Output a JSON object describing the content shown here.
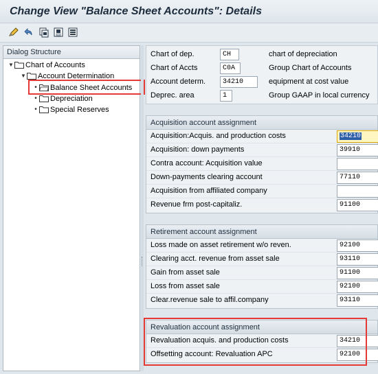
{
  "window": {
    "title": "Change View \"Balance Sheet Accounts\": Details"
  },
  "toolbar": {
    "buttons": [
      "edit-icon",
      "undo-icon",
      "copy-icon",
      "save-icon",
      "list-icon"
    ]
  },
  "dialog_structure": {
    "title": "Dialog Structure",
    "nodes": [
      {
        "label": "Chart of Accounts",
        "level": 0,
        "expanded": true
      },
      {
        "label": "Account Determination",
        "level": 1,
        "expanded": true
      },
      {
        "label": "Balance Sheet Accounts",
        "level": 2,
        "selected": true
      },
      {
        "label": "Depreciation",
        "level": 2
      },
      {
        "label": "Special Reserves",
        "level": 2
      }
    ]
  },
  "header": {
    "rows": [
      {
        "label": "Chart of dep.",
        "value": "CH",
        "desc": "chart of depreciation"
      },
      {
        "label": "Chart of Accts",
        "value": "C0A",
        "desc": "Group Chart of Accounts"
      },
      {
        "label": "Account determ.",
        "value": "34210",
        "desc": "equipment at cost value"
      },
      {
        "label": "Deprec. area",
        "value": "1",
        "desc": "Group GAAP in local currency"
      }
    ]
  },
  "groups": [
    {
      "title": "Acquisition account assignment",
      "rows": [
        {
          "label": "Acquisition:Acquis. and production costs",
          "value": "34210",
          "active": true
        },
        {
          "label": "Acquisition: down payments",
          "value": "39910"
        },
        {
          "label": "Contra account: Acquisition value",
          "value": ""
        },
        {
          "label": "Down-payments clearing account",
          "value": "77110"
        },
        {
          "label": "Acquisition from affiliated company",
          "value": ""
        },
        {
          "label": "Revenue frm post-capitaliz.",
          "value": "91100"
        }
      ]
    },
    {
      "title": "Retirement account assignment",
      "rows": [
        {
          "label": "Loss made on asset retirement w/o reven.",
          "value": "92100"
        },
        {
          "label": "Clearing acct. revenue from asset sale",
          "value": "93110"
        },
        {
          "label": "Gain from asset sale",
          "value": "91100"
        },
        {
          "label": "Loss from asset sale",
          "value": "92100"
        },
        {
          "label": "Clear.revenue sale to affil.company",
          "value": "93110"
        }
      ]
    },
    {
      "title": "Revaluation account assignment",
      "rows": [
        {
          "label": "Revaluation acquis. and production costs",
          "value": "34210"
        },
        {
          "label": "Offsetting account: Revaluation APC",
          "value": "92100"
        }
      ]
    }
  ],
  "colors": {
    "highlight": "#e53935",
    "active_field": "#fff6c2",
    "selection": "#2d5ea7"
  }
}
